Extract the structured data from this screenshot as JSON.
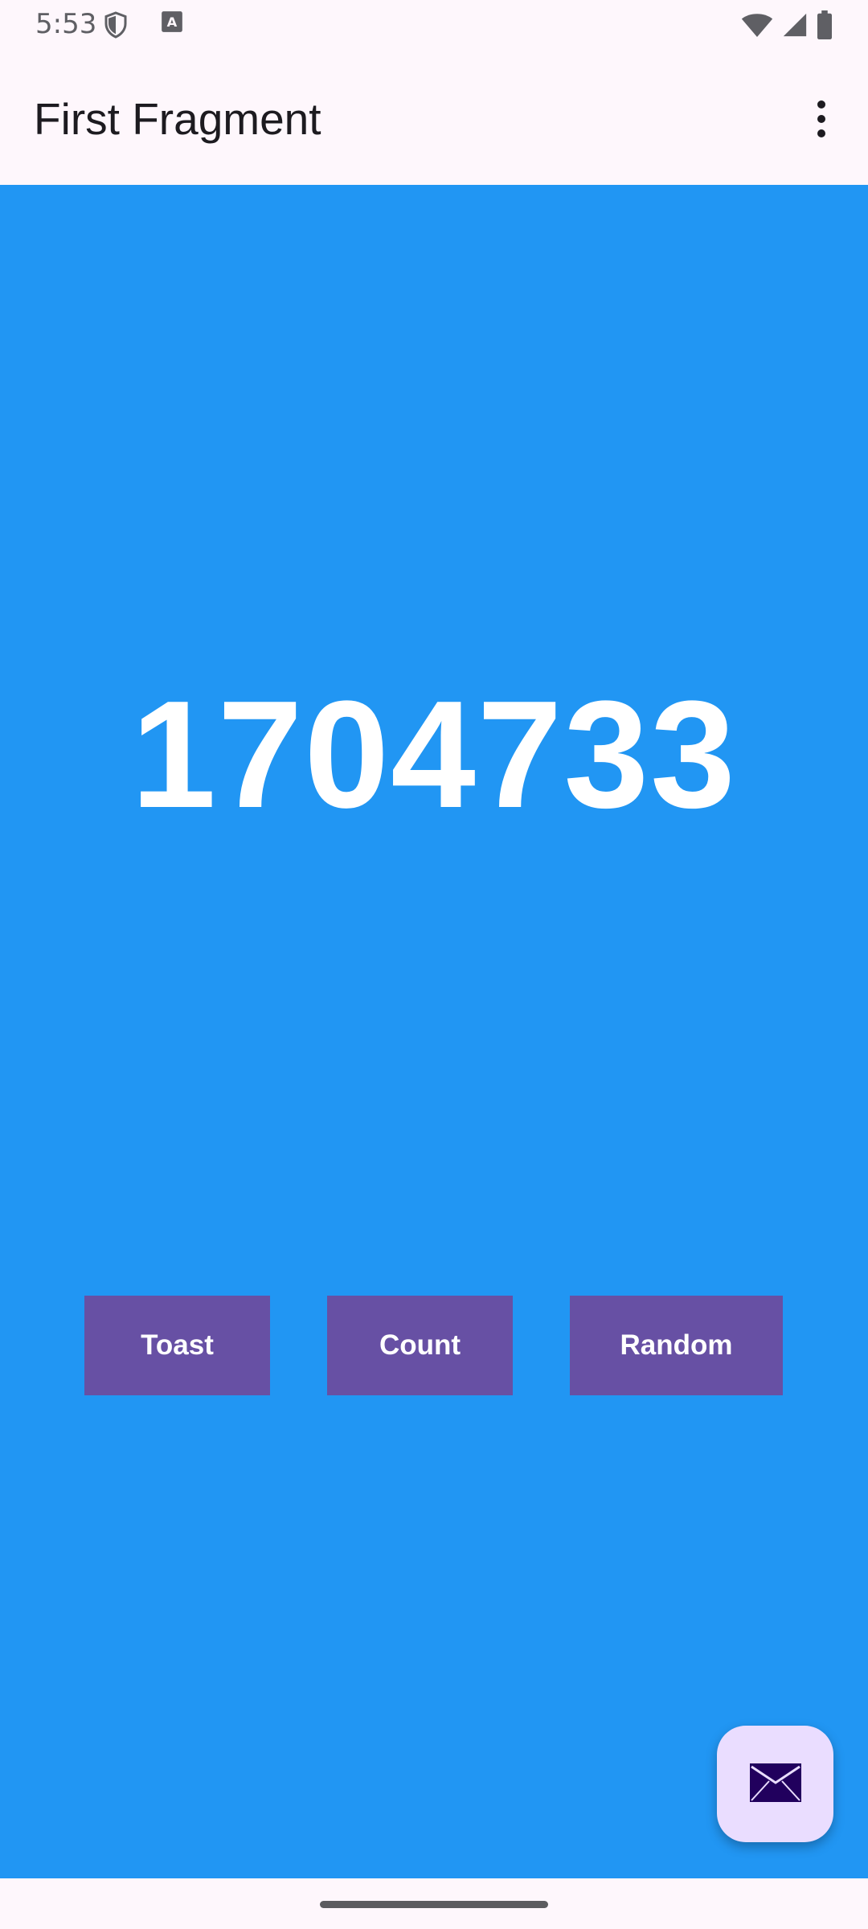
{
  "status_bar": {
    "time": "5:53",
    "left_icons": [
      "shield-icon",
      "text-a-icon"
    ],
    "right_icons": [
      "wifi-icon",
      "signal-icon",
      "battery-icon"
    ]
  },
  "app_bar": {
    "title": "First Fragment",
    "overflow_icon": "more-vert-icon"
  },
  "main": {
    "background_color": "#2196F3",
    "number": "1704733",
    "buttons": {
      "toast": "Toast",
      "count": "Count",
      "random": "Random"
    },
    "button_color": "#6750A4",
    "fab_icon": "email-icon"
  }
}
